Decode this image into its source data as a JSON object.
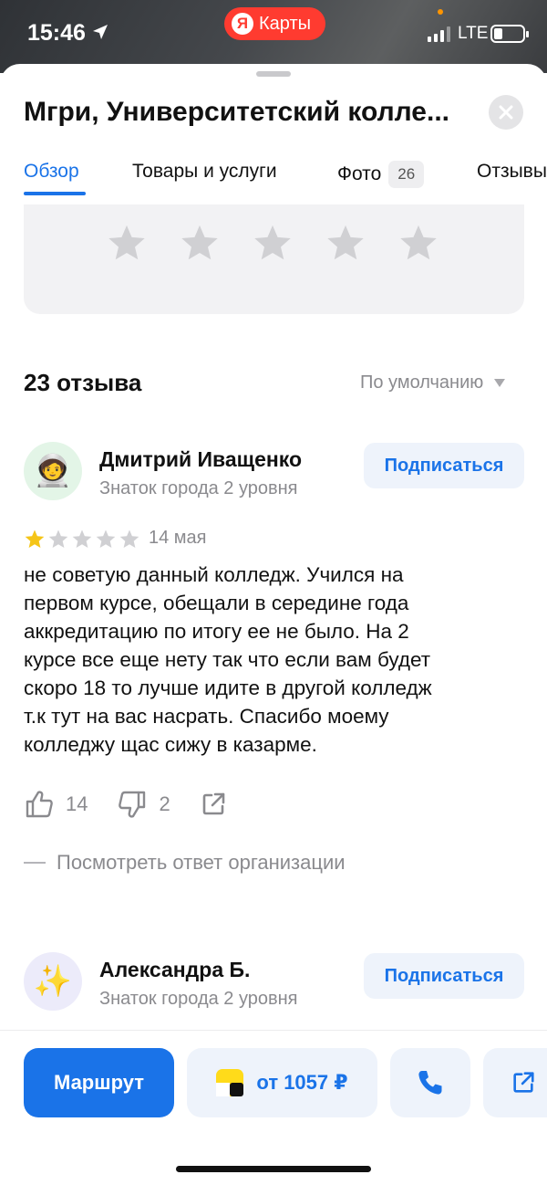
{
  "status_bar": {
    "time": "15:46",
    "app_pill": {
      "logo_letter": "Я",
      "label": "Карты"
    },
    "network": "LTE",
    "battery_level": 0.3
  },
  "header": {
    "title": "Мгри, Университетский колле...",
    "close_icon": "close-icon"
  },
  "tabs": [
    {
      "label": "Обзор",
      "active": true
    },
    {
      "label": "Товары и услуги"
    },
    {
      "label": "Фото",
      "badge": "26"
    },
    {
      "label": "Отзывы"
    }
  ],
  "rating_box": {
    "stars_empty": 5
  },
  "reviews_header": {
    "count_label": "23 отзыва",
    "sort_label": "По умолчанию"
  },
  "reviews": [
    {
      "avatar_emoji": "🧑‍🚀",
      "name": "Дмитрий Иващенко",
      "level": "Знаток города 2 уровня",
      "subscribe_label": "Подписаться",
      "rating": 1,
      "date": "14 мая",
      "text_lines": [
        "не советую данный колледж. Учился на",
        "первом курсе, обещали в середине года",
        "аккредитацию  по итогу ее не было. На 2",
        "курсе все еще нету так что если вам будет",
        "скоро 18 то лучше идите в другой колледж",
        "т.к тут на вас насрать. Спасибо моему",
        "колледжу щас сижу в казарме."
      ],
      "likes": "14",
      "dislikes": "2",
      "reply_label": "Посмотреть ответ организации"
    },
    {
      "avatar_emoji": "✨",
      "name": "Александра Б.",
      "level": "Знаток города 2 уровня",
      "subscribe_label": "Подписаться"
    }
  ],
  "bottom_bar": {
    "route_label": "Маршрут",
    "taxi_label": "от 1057 ₽",
    "call_icon": "phone-icon",
    "share_icon": "share-icon"
  },
  "colors": {
    "accent": "#1a73e8",
    "star_filled": "#f5c518",
    "star_empty": "#d0d0d3",
    "pill": "#ff3b30"
  }
}
